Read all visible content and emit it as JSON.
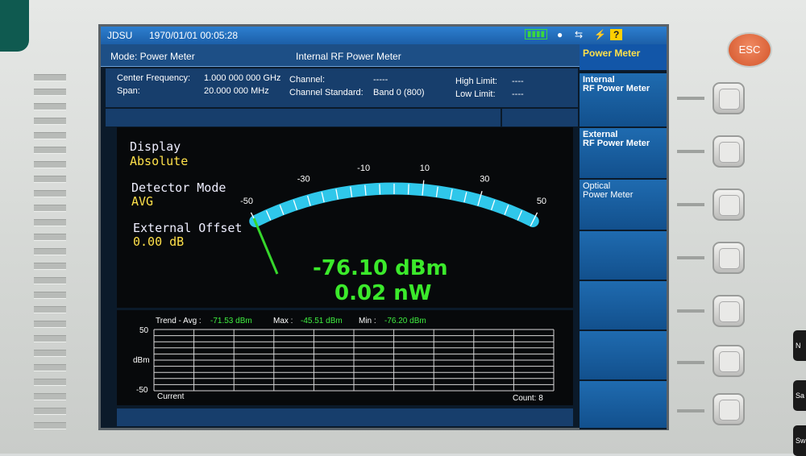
{
  "titlebar": {
    "brand": "JDSU",
    "datetime": "1970/01/01 00:05:28",
    "status_icons": [
      "battery-icon",
      "mouse-icon",
      "usb-icon",
      "plug-icon",
      "help-icon"
    ]
  },
  "mode": {
    "label": "Mode: Power Meter",
    "title": "Internal RF Power Meter"
  },
  "info": {
    "center_freq_label": "Center Frequency:",
    "center_freq_value": "1.000 000 000 GHz",
    "span_label": "Span:",
    "span_value": "20.000 000 MHz",
    "channel_label": "Channel:",
    "channel_value": "-----",
    "channel_std_label": "Channel Standard:",
    "channel_std_value": "Band 0 (800)",
    "high_limit_label": "High Limit:",
    "high_limit_value": "----",
    "low_limit_label": "Low Limit:",
    "low_limit_value": "----"
  },
  "meter": {
    "display_label": "Display",
    "display_value": "Absolute",
    "detector_label": "Detector Mode",
    "detector_value": "AVG",
    "offset_label": "External Offset",
    "offset_value": "0.00 dB",
    "scale_labels": [
      "-50",
      "-30",
      "-10",
      "10",
      "30",
      "50"
    ],
    "reading_dbm": "-76.10 dBm",
    "reading_watt": "0.02 nW",
    "needle_value": -76.1,
    "scale_min": -50,
    "scale_max": 50
  },
  "trend": {
    "title_label": "Trend - Avg :",
    "avg_value": "-71.53 dBm",
    "max_label": "Max :",
    "max_value": "-45.51 dBm",
    "min_label": "Min :",
    "min_value": "-76.20 dBm",
    "y_top": "50",
    "y_unit": "dBm",
    "y_bottom": "-50",
    "current_label": "Current",
    "count_label": "Count: 8"
  },
  "softkeys": [
    {
      "label": "Power Meter"
    },
    {
      "label": "Internal\nRF Power Meter"
    },
    {
      "label": "External\nRF Power Meter"
    },
    {
      "label": "Optical\nPower Meter"
    },
    {
      "label": ""
    },
    {
      "label": ""
    },
    {
      "label": ""
    },
    {
      "label": ""
    }
  ],
  "hardware": {
    "esc_label": "ESC",
    "edge_labels": [
      "N",
      "Sa",
      "Sw"
    ]
  },
  "colors": {
    "accent_blue": "#1d4f86",
    "meter_arc": "#2fc7ea",
    "needle": "#36d62c",
    "reading": "#3bea2b",
    "value_yellow": "#ffe14a"
  }
}
